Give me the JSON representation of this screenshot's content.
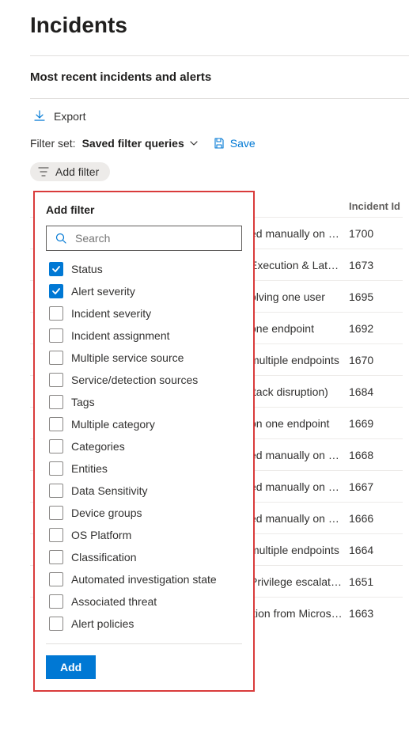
{
  "page_title": "Incidents",
  "section_title": "Most recent incidents and alerts",
  "export_label": "Export",
  "filterset": {
    "label": "Filter set:",
    "value": "Saved filter queries",
    "save_label": "Save"
  },
  "addfilter_chip": "Add filter",
  "popup": {
    "title": "Add filter",
    "search_placeholder": "Search",
    "options": [
      {
        "label": "Status",
        "checked": true
      },
      {
        "label": "Alert severity",
        "checked": true
      },
      {
        "label": "Incident severity",
        "checked": false
      },
      {
        "label": "Incident assignment",
        "checked": false
      },
      {
        "label": "Multiple service source",
        "checked": false
      },
      {
        "label": "Service/detection sources",
        "checked": false
      },
      {
        "label": "Tags",
        "checked": false
      },
      {
        "label": "Multiple category",
        "checked": false
      },
      {
        "label": "Categories",
        "checked": false
      },
      {
        "label": "Entities",
        "checked": false
      },
      {
        "label": "Data Sensitivity",
        "checked": false
      },
      {
        "label": "Device groups",
        "checked": false
      },
      {
        "label": "OS Platform",
        "checked": false
      },
      {
        "label": "Classification",
        "checked": false
      },
      {
        "label": "Automated investigation state",
        "checked": false
      },
      {
        "label": "Associated threat",
        "checked": false
      },
      {
        "label": "Alert policies",
        "checked": false
      }
    ],
    "add_label": "Add"
  },
  "table": {
    "header_name": "",
    "header_id": "Incident Id",
    "rows": [
      {
        "name": "ed manually on o…",
        "id": "1700"
      },
      {
        "name": "Execution & Late…",
        "id": "1673"
      },
      {
        "name": "olving one user",
        "id": "1695"
      },
      {
        "name": "one endpoint",
        "id": "1692"
      },
      {
        "name": "multiple endpoints",
        "id": "1670"
      },
      {
        "name": "ttack disruption)",
        "id": "1684"
      },
      {
        "name": "on one endpoint",
        "id": "1669"
      },
      {
        "name": "ed manually on o…",
        "id": "1668"
      },
      {
        "name": "ed manually on o…",
        "id": "1667"
      },
      {
        "name": "ed manually on o…",
        "id": "1666"
      },
      {
        "name": "multiple endpoints",
        "id": "1664"
      },
      {
        "name": "Privilege escalati…",
        "id": "1651"
      },
      {
        "name": "ition from Micros…",
        "id": "1663"
      }
    ]
  }
}
